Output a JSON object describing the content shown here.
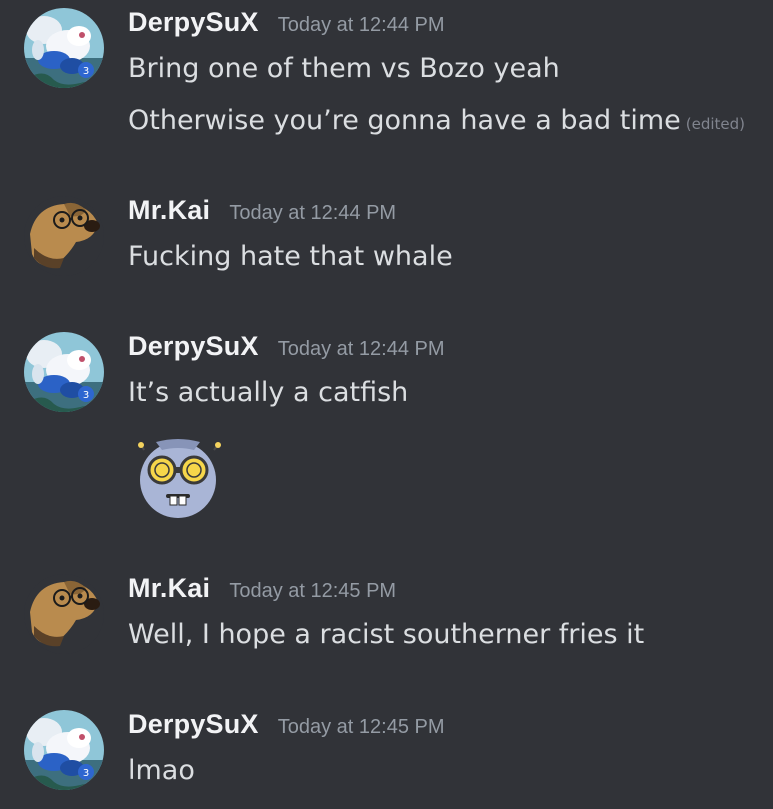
{
  "messages": [
    {
      "author": "DerpySuX",
      "timestamp": "Today at 12:44 PM",
      "avatar_icon": "pokemon-avatar-icon",
      "lines": [
        {
          "text": "Bring one of them vs Bozo yeah",
          "edited": ""
        },
        {
          "text": "Otherwise you’re gonna have a bad time",
          "edited": "(edited)"
        }
      ]
    },
    {
      "author": "Mr.Kai",
      "timestamp": "Today at 12:44 PM",
      "avatar_icon": "dog-with-glasses-avatar-icon",
      "lines": [
        {
          "text": "Fucking hate that whale",
          "edited": ""
        }
      ]
    },
    {
      "author": "DerpySuX",
      "timestamp": "Today at 12:44 PM",
      "avatar_icon": "pokemon-avatar-icon",
      "lines": [
        {
          "text": "It’s actually a catfish",
          "edited": ""
        }
      ],
      "emoji": "nerd-robot-emoji-icon"
    },
    {
      "author": "Mr.Kai",
      "timestamp": "Today at 12:45 PM",
      "avatar_icon": "dog-with-glasses-avatar-icon",
      "lines": [
        {
          "text": "Well, I hope a racist southerner fries it",
          "edited": ""
        }
      ]
    },
    {
      "author": "DerpySuX",
      "timestamp": "Today at 12:45 PM",
      "avatar_icon": "pokemon-avatar-icon",
      "lines": [
        {
          "text": "lmao",
          "edited": ""
        }
      ]
    }
  ],
  "colors": {
    "background": "#313338",
    "username": "#f2f3f5",
    "timestamp": "#949ba4",
    "message_text": "#dbdee1",
    "edited": "#80848e"
  }
}
